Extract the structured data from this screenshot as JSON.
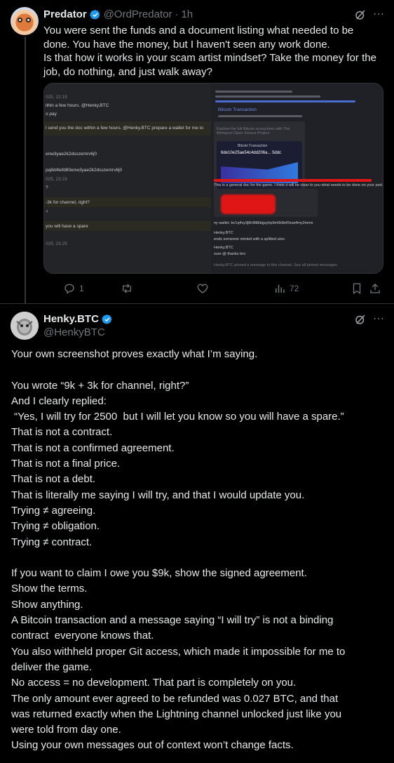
{
  "parent_tweet": {
    "name": "Predator",
    "handle": "@OrdPredator",
    "separator": "·",
    "time": "1h",
    "text": "You were sent the funds and a document listing what needed to be done. You have the money, but I haven't seen any work done.\nIs that how it works in your scam artist mindset? Take the money for the job, do nothing, and just walk away?",
    "media": {
      "left_lines": [
        "025, 22:19",
        "ithin a few hours. @Henky.BTC",
        "o pay",
        "l send you the doc within a few hours. @Henky.BTC  prepare a wallet for me to",
        "enw3yae2k2dsszemrv6j0",
        "pq8d4tefd80enw3yae2k2dsszemrv6j0",
        "025, 23:23",
        "?",
        "-3k for channel, right?",
        "4",
        "you will have a spare",
        "025, 23:25"
      ],
      "right_lines": [
        "Bitcoin Transaction",
        "Explore the full Bitcoin ecosystem with The Mempool Open Source Project",
        "Bitcoin Transaction",
        "6de10e25ae54c4dd206a... 5ddc",
        "This is a general doc for the game. I think it will be clear to you what needs to be done on your part.",
        "ny wallet: bc1q4vy3j8n9lt8dqjuyhp9m5k8ef0vsa4my2mmx",
        "Henky.BTC",
        "ends someone minted with a splitted utxo",
        "Henky.BTC",
        "sure @ thanks bro",
        "Henky.BTC  pinned a message to this channel. See all pinned messages."
      ]
    },
    "actions": {
      "replies": "1",
      "retweets": "",
      "likes": "",
      "views": "72"
    }
  },
  "main_tweet": {
    "name": "Henky.BTC",
    "handle": "@HenkyBTC",
    "lines": [
      "Your own screenshot proves exactly what I’m saying.",
      "",
      "You wrote “9k + 3k for channel, right?”",
      "And I clearly replied:",
      " “Yes, I will try for 2500  but I will let you know so you will have a spare.”",
      "That is not a contract.",
      "That is not a confirmed agreement.",
      "That is not a final price.",
      "That is not a debt.",
      "That is literally me saying I will try, and that I would update you.",
      "Trying ≠ agreeing.",
      "Trying ≠ obligation.",
      "Trying ≠ contract.",
      "",
      "If you want to claim I owe you $9k, show the signed agreement.",
      "Show the terms.",
      "Show anything.",
      "A Bitcoin transaction and a message saying “I will try” is not a binding",
      "contract  everyone knows that.",
      "You also withheld proper Git access, which made it impossible for me to",
      "deliver the game.",
      "No access = no development. That part is completely on you.",
      "The only amount ever agreed to be refunded was 0.027 BTC, and that",
      "was returned exactly when the Lightning channel unlocked just like you",
      "were told from day one.",
      "Using your own messages out of context won’t change facts."
    ]
  },
  "icons": [
    "verified-badge-icon",
    "grok-icon",
    "more-icon",
    "reply-icon",
    "retweet-icon",
    "like-icon",
    "views-icon",
    "bookmark-icon",
    "share-icon"
  ],
  "colors": {
    "background": "#000000",
    "text": "#e7e9ea",
    "muted": "#71767b",
    "verified": "#1d9bf0",
    "redaction": "#e01515"
  }
}
